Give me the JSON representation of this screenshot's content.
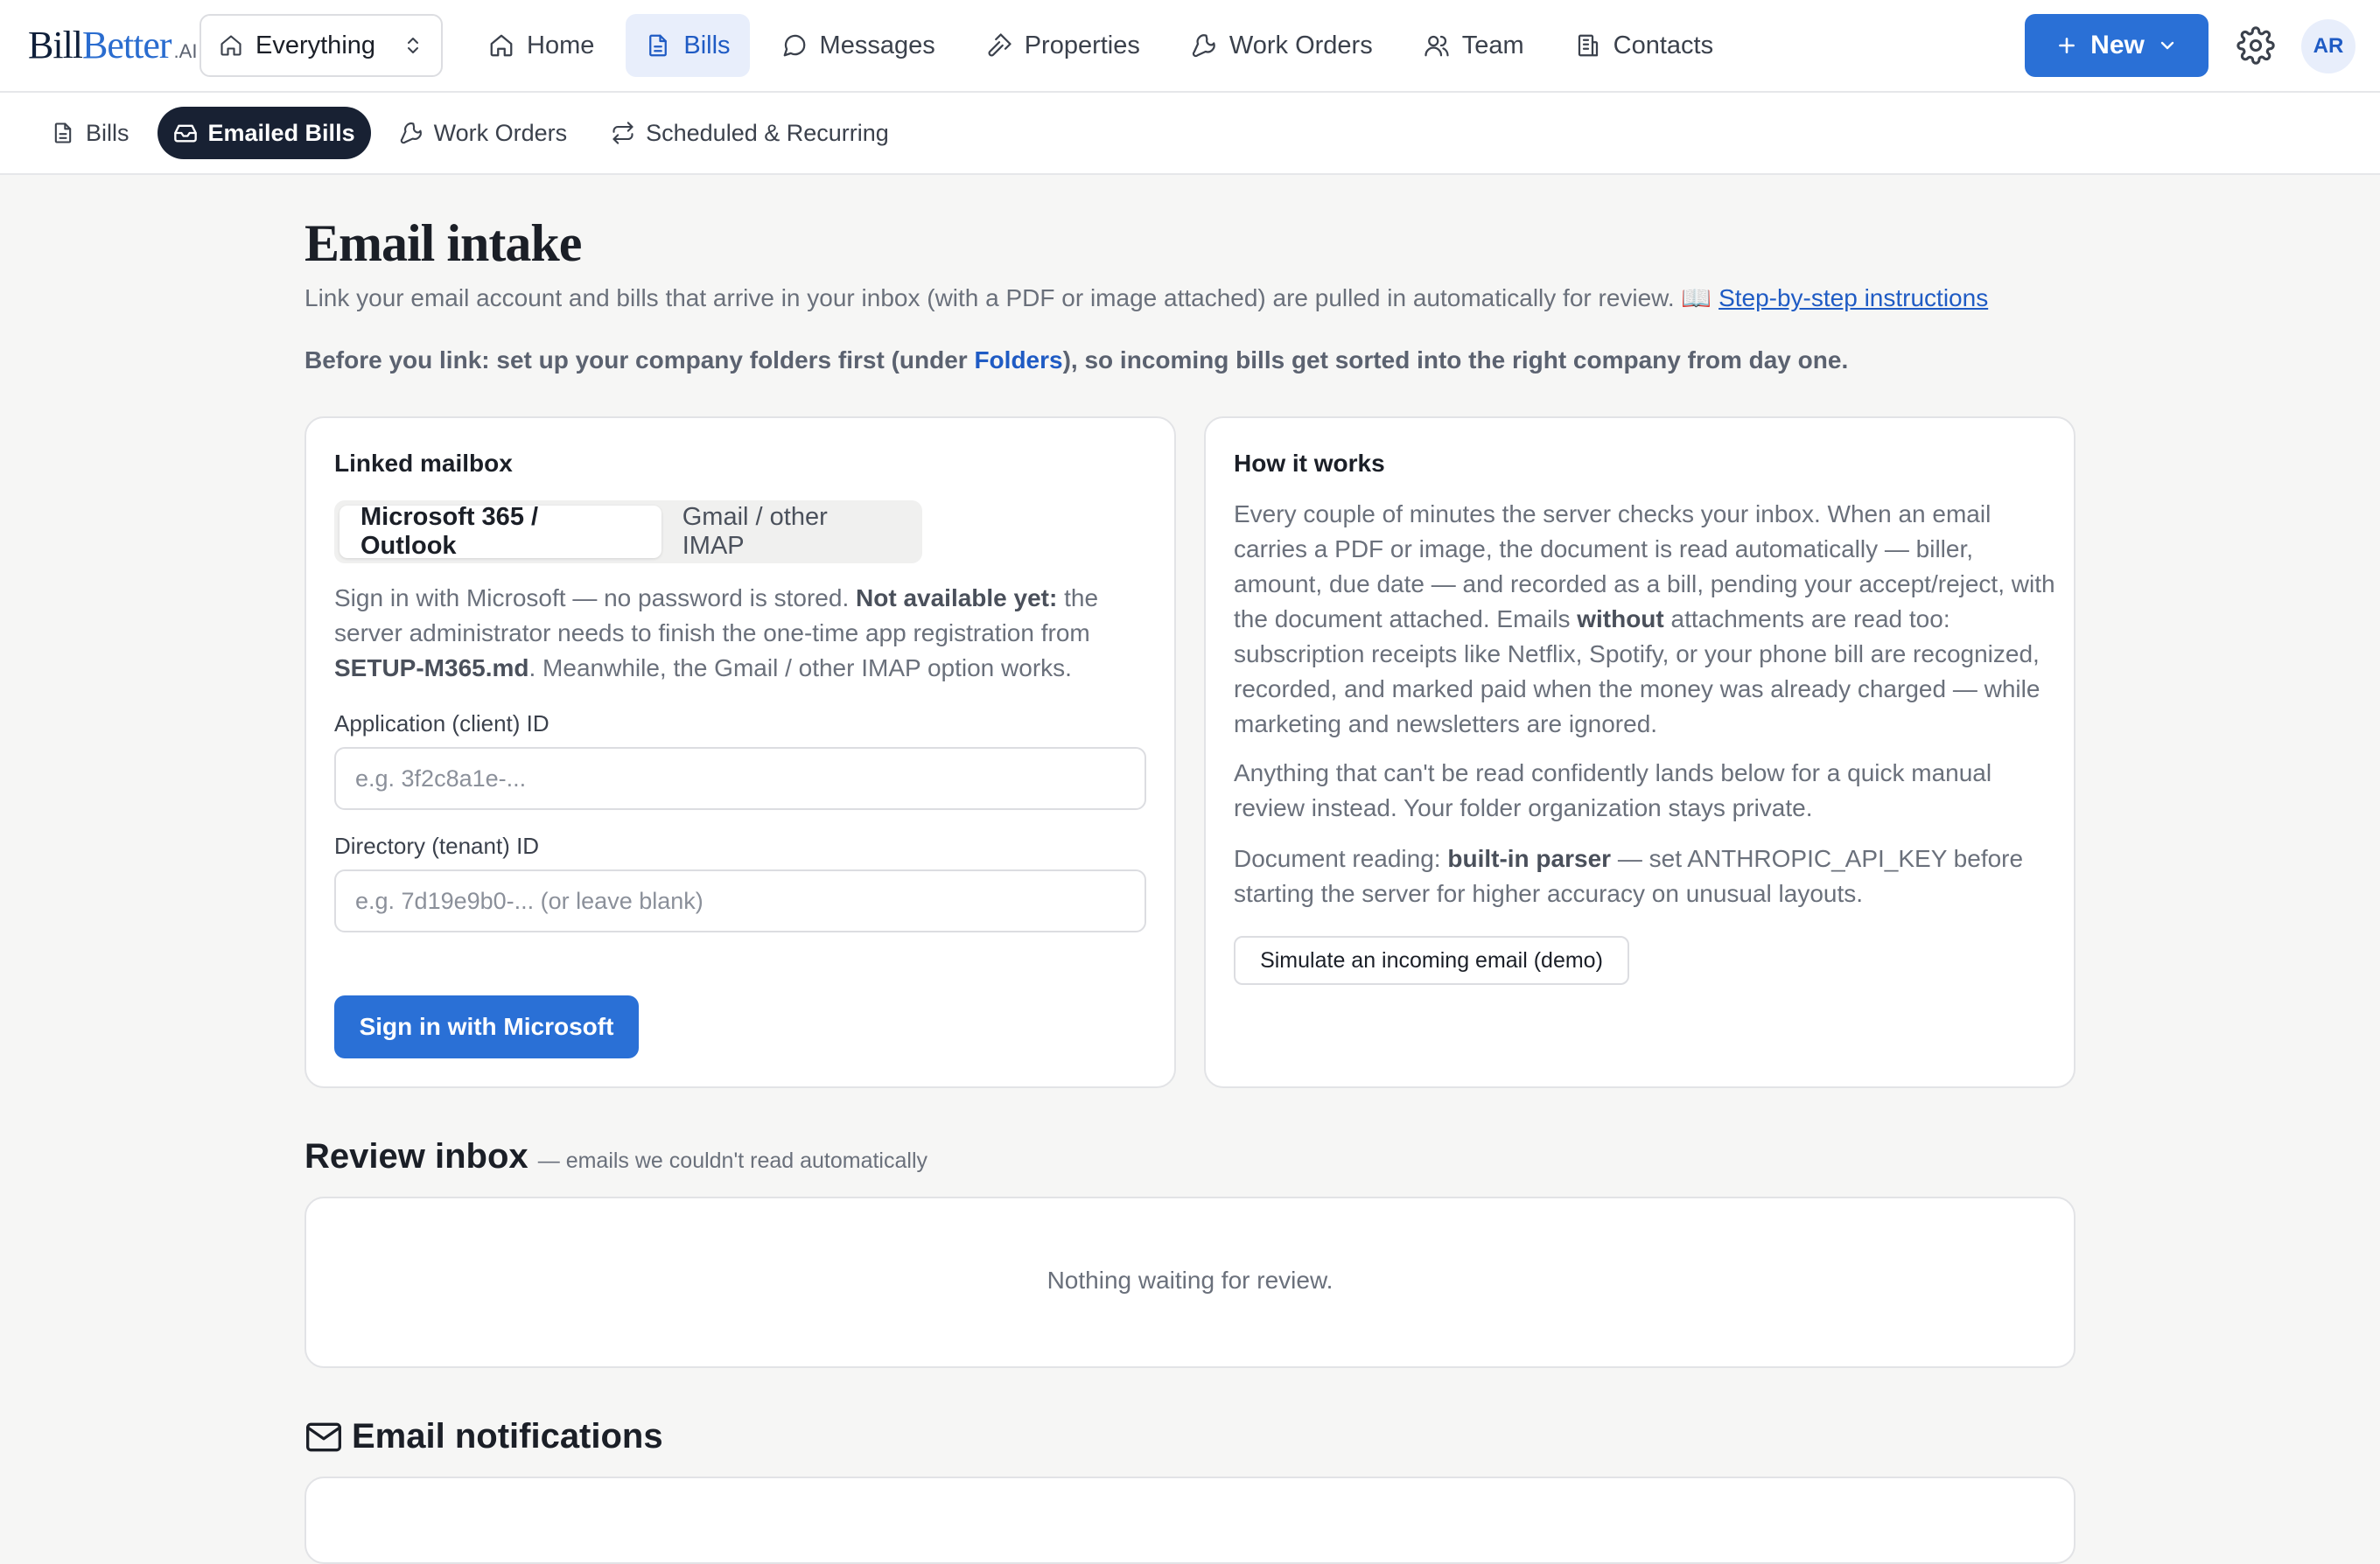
{
  "brand": {
    "bill": "Bill",
    "better": "Better",
    "ai": ".AI"
  },
  "scope": {
    "label": "Everything",
    "icon": "home-icon"
  },
  "nav": [
    {
      "label": "Home",
      "icon": "home-icon",
      "active": false
    },
    {
      "label": "Bills",
      "icon": "document-icon",
      "active": true
    },
    {
      "label": "Messages",
      "icon": "chat-bubble-icon",
      "active": false
    },
    {
      "label": "Properties",
      "icon": "hammer-icon",
      "active": false
    },
    {
      "label": "Work Orders",
      "icon": "wrench-icon",
      "active": false
    },
    {
      "label": "Team",
      "icon": "users-icon",
      "active": false
    },
    {
      "label": "Contacts",
      "icon": "building-icon",
      "active": false
    }
  ],
  "header": {
    "new_label": "New",
    "avatar_initials": "AR"
  },
  "subnav": [
    {
      "label": "Bills",
      "icon": "document-icon",
      "active": false
    },
    {
      "label": "Emailed Bills",
      "icon": "inbox-icon",
      "active": true
    },
    {
      "label": "Work Orders",
      "icon": "wrench-icon",
      "active": false
    },
    {
      "label": "Scheduled & Recurring",
      "icon": "repeat-icon",
      "active": false
    }
  ],
  "page": {
    "title": "Email intake",
    "intro": "Link your email account and bills that arrive in your inbox (with a PDF or image attached) are pulled in automatically for review. 📖",
    "instructions_link": "Step-by-step instructions",
    "notice_pre": "Before you link: set up your company folders first (under ",
    "notice_link": "Folders",
    "notice_post": "), so incoming bills get sorted into the right company from day one."
  },
  "mailbox": {
    "title": "Linked mailbox",
    "tabs": [
      "Microsoft 365 / Outlook",
      "Gmail / other IMAP"
    ],
    "active_tab": 0,
    "desc_1": "Sign in with Microsoft — no password is stored. ",
    "desc_bold_1": "Not available yet:",
    "desc_2": " the server administrator needs to finish the one-time app registration from ",
    "desc_bold_2": "SETUP-M365.md",
    "desc_3": ". Meanwhile, the Gmail / other IMAP option works.",
    "client_id_label": "Application (client) ID",
    "client_id_placeholder": "e.g. 3f2c8a1e-...",
    "tenant_id_label": "Directory (tenant) ID",
    "tenant_id_placeholder": "e.g. 7d19e9b0-... (or leave blank)",
    "signin_label": "Sign in with Microsoft"
  },
  "how": {
    "title": "How it works",
    "p1_a": "Every couple of minutes the server checks your inbox. When an email carries a PDF or image, the document is read automatically — biller, amount, due date — and recorded as a bill, pending your accept/reject, with the document attached. Emails ",
    "p1_bold": "without",
    "p1_b": " attachments are read too: subscription receipts like Netflix, Spotify, or your phone bill are recognized, recorded, and marked paid when the money was already charged — while marketing and newsletters are ignored.",
    "p2": "Anything that can't be read confidently lands below for a quick manual review instead. Your folder organization stays private.",
    "p3_a": "Document reading: ",
    "p3_bold": "built-in parser",
    "p3_b": " — set ANTHROPIC_API_KEY before starting the server for higher accuracy on unusual layouts.",
    "demo_label": "Simulate an incoming email (demo)"
  },
  "review": {
    "title": "Review inbox",
    "subtitle": "— emails we couldn't read automatically",
    "empty": "Nothing waiting for review."
  },
  "notifications": {
    "title": "Email notifications"
  },
  "colors": {
    "accent": "#2a70d6",
    "accent_soft": "#e8eefb",
    "dark_pill": "#182133"
  }
}
